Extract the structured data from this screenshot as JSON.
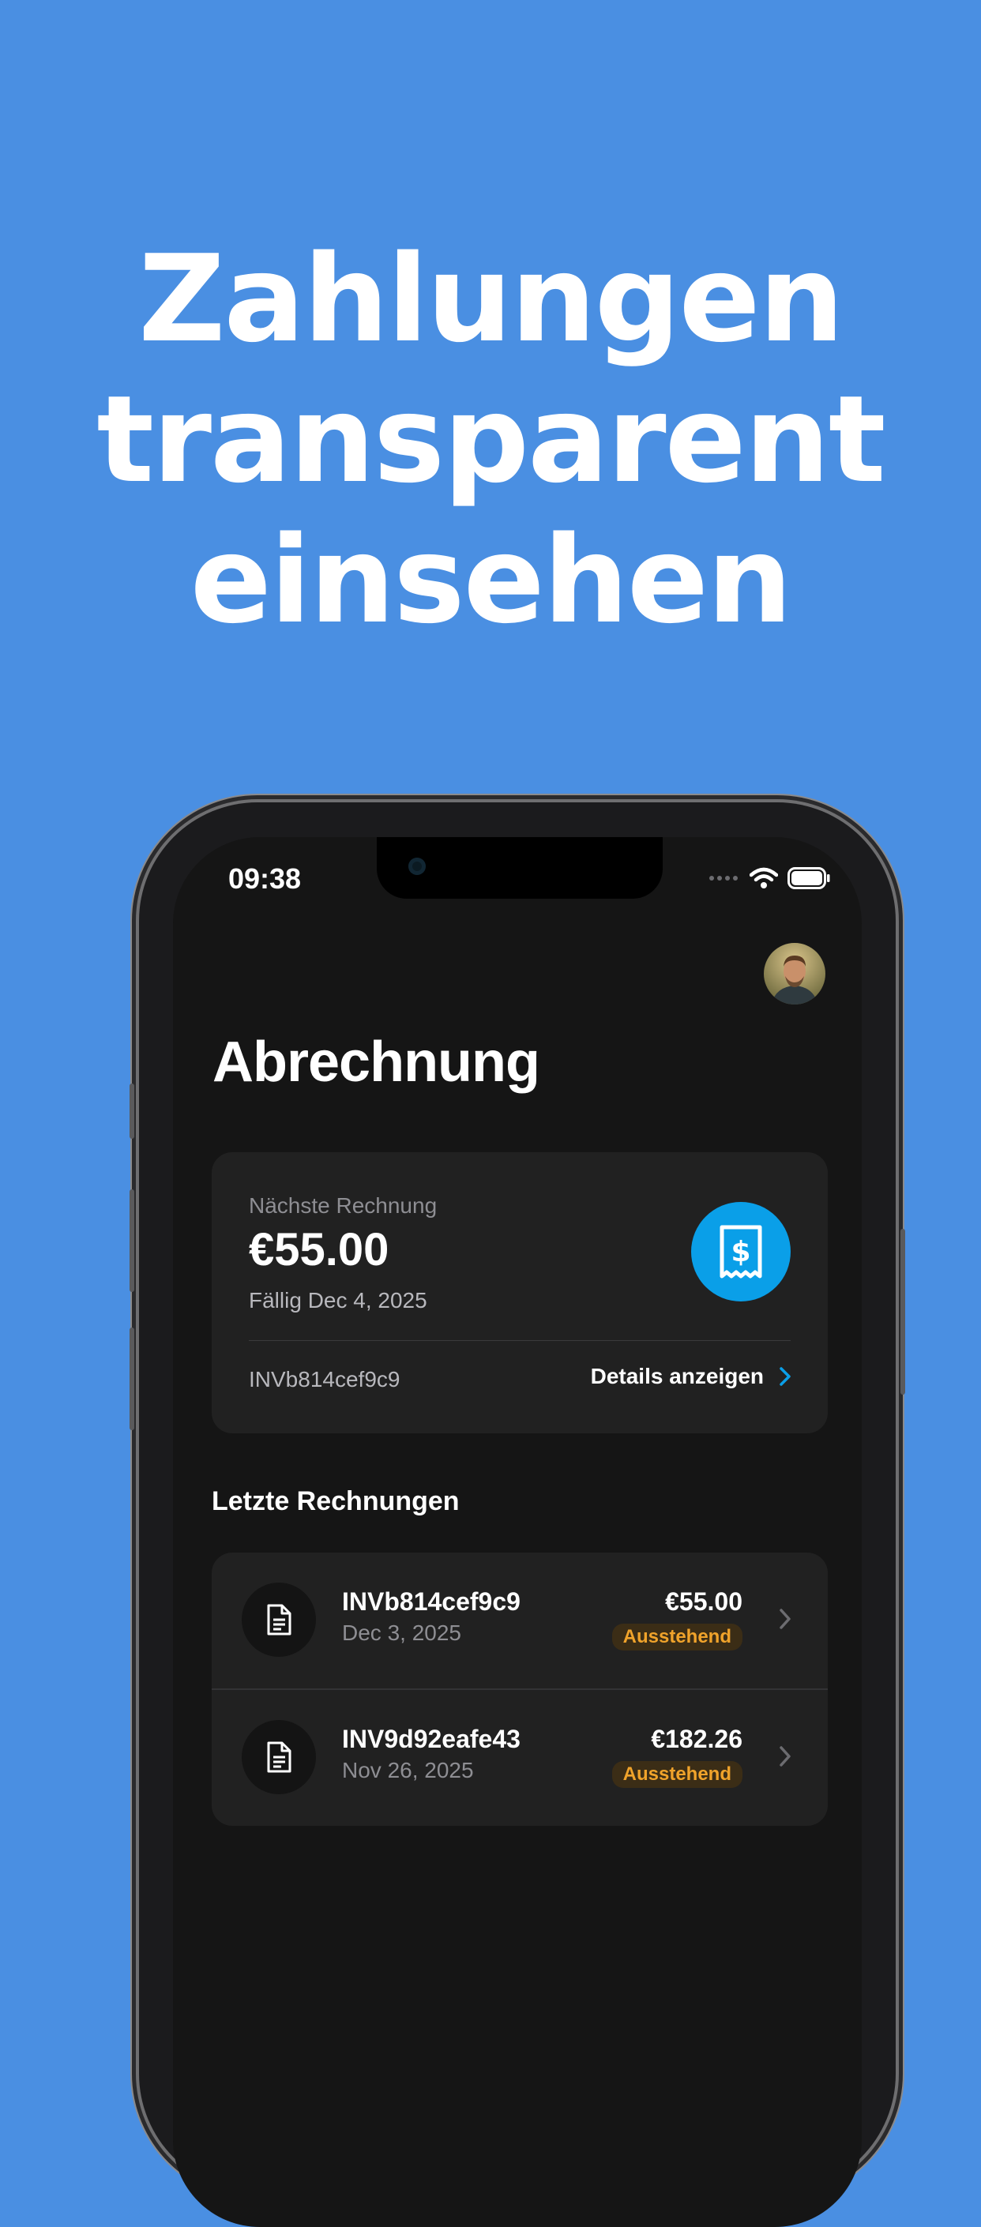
{
  "headline": {
    "line1": "Zahlungen",
    "line2": "transparent",
    "line3": "einsehen"
  },
  "status_bar": {
    "time": "09:38"
  },
  "page": {
    "title": "Abrechnung"
  },
  "next_invoice": {
    "label": "Nächste Rechnung",
    "amount": "€55.00",
    "due": "Fällig Dec 4, 2025",
    "invoice_id": "INVb814cef9c9",
    "details_label": "Details anzeigen"
  },
  "recent": {
    "title": "Letzte Rechnungen",
    "items": [
      {
        "number": "INVb814cef9c9",
        "date": "Dec 3, 2025",
        "amount": "€55.00",
        "status": "Ausstehend"
      },
      {
        "number": "INV9d92eafe43",
        "date": "Nov 26, 2025",
        "amount": "€182.26",
        "status": "Ausstehend"
      }
    ]
  },
  "colors": {
    "background": "#4a8fe2",
    "screen": "#151515",
    "card": "#212121",
    "accent": "#0a9fe8",
    "pending": "#f0a32b"
  },
  "icons": [
    "receipt-dollar-icon",
    "document-icon",
    "chevron-right-icon",
    "wifi-icon",
    "battery-icon",
    "cellular-icon"
  ]
}
